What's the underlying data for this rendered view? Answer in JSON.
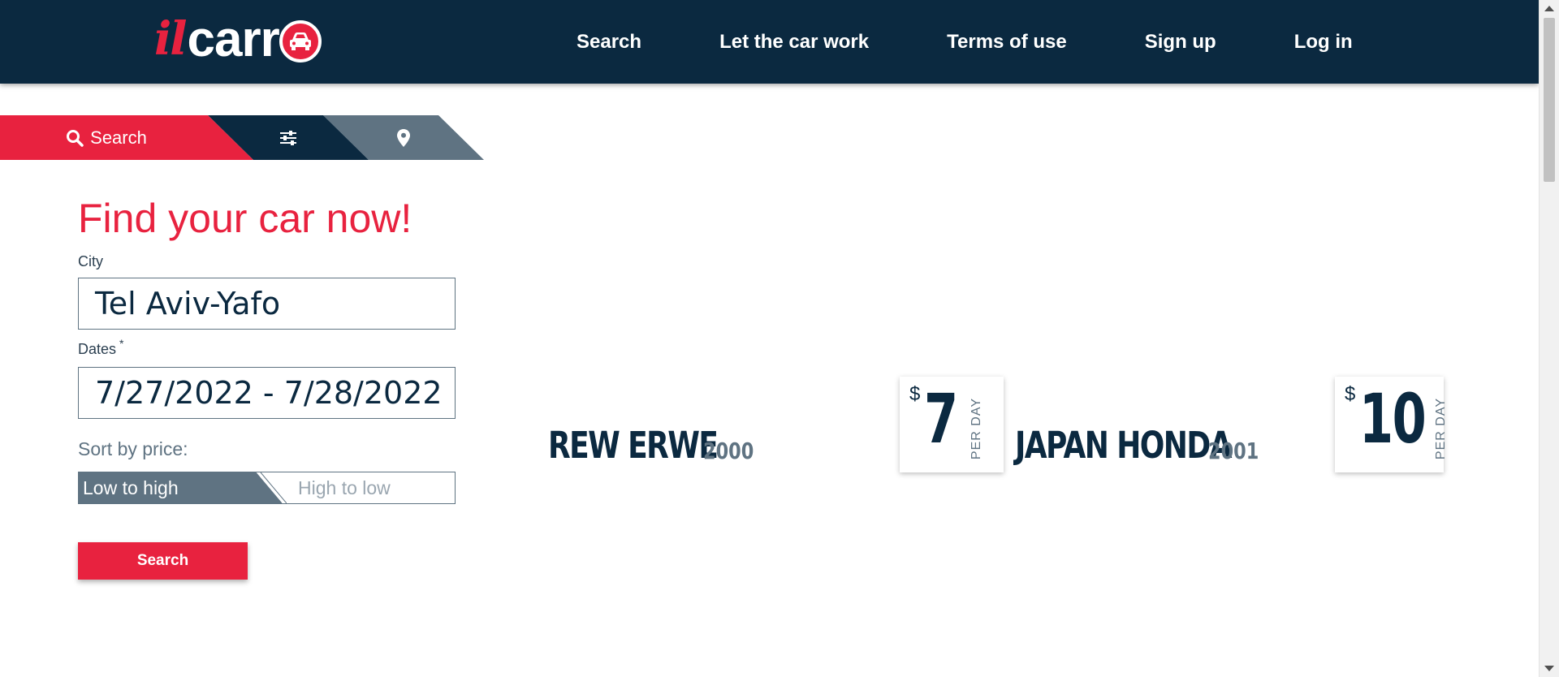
{
  "brand": {
    "logo_il": "il",
    "logo_carr": "carr"
  },
  "nav": {
    "items": [
      {
        "label": "Search"
      },
      {
        "label": "Let the car work"
      },
      {
        "label": "Terms of use"
      },
      {
        "label": "Sign up"
      },
      {
        "label": "Log in"
      }
    ]
  },
  "tabs": {
    "search_label": "Search"
  },
  "form": {
    "title": "Find your car now!",
    "city_label": "City",
    "city_value": "Tel Aviv-Yafo",
    "dates_label": "Dates",
    "dates_required": "*",
    "dates_value": "7/27/2022 - 7/28/2022",
    "sort_label": "Sort by price:",
    "sort_low": "Low to high",
    "sort_high": "High to low",
    "sort_selected": "Low to high",
    "search_button": "Search"
  },
  "cars": [
    {
      "name": "REW ERWE",
      "year": "2000",
      "currency": "$",
      "price": "7",
      "unit": "PER DAY"
    },
    {
      "name": "JAPAN HONDA",
      "year": "2001",
      "currency": "$",
      "price": "10",
      "unit": "PER DAY"
    }
  ],
  "colors": {
    "primary": "#0b2940",
    "accent": "#e8223f",
    "muted": "#5f7382"
  }
}
